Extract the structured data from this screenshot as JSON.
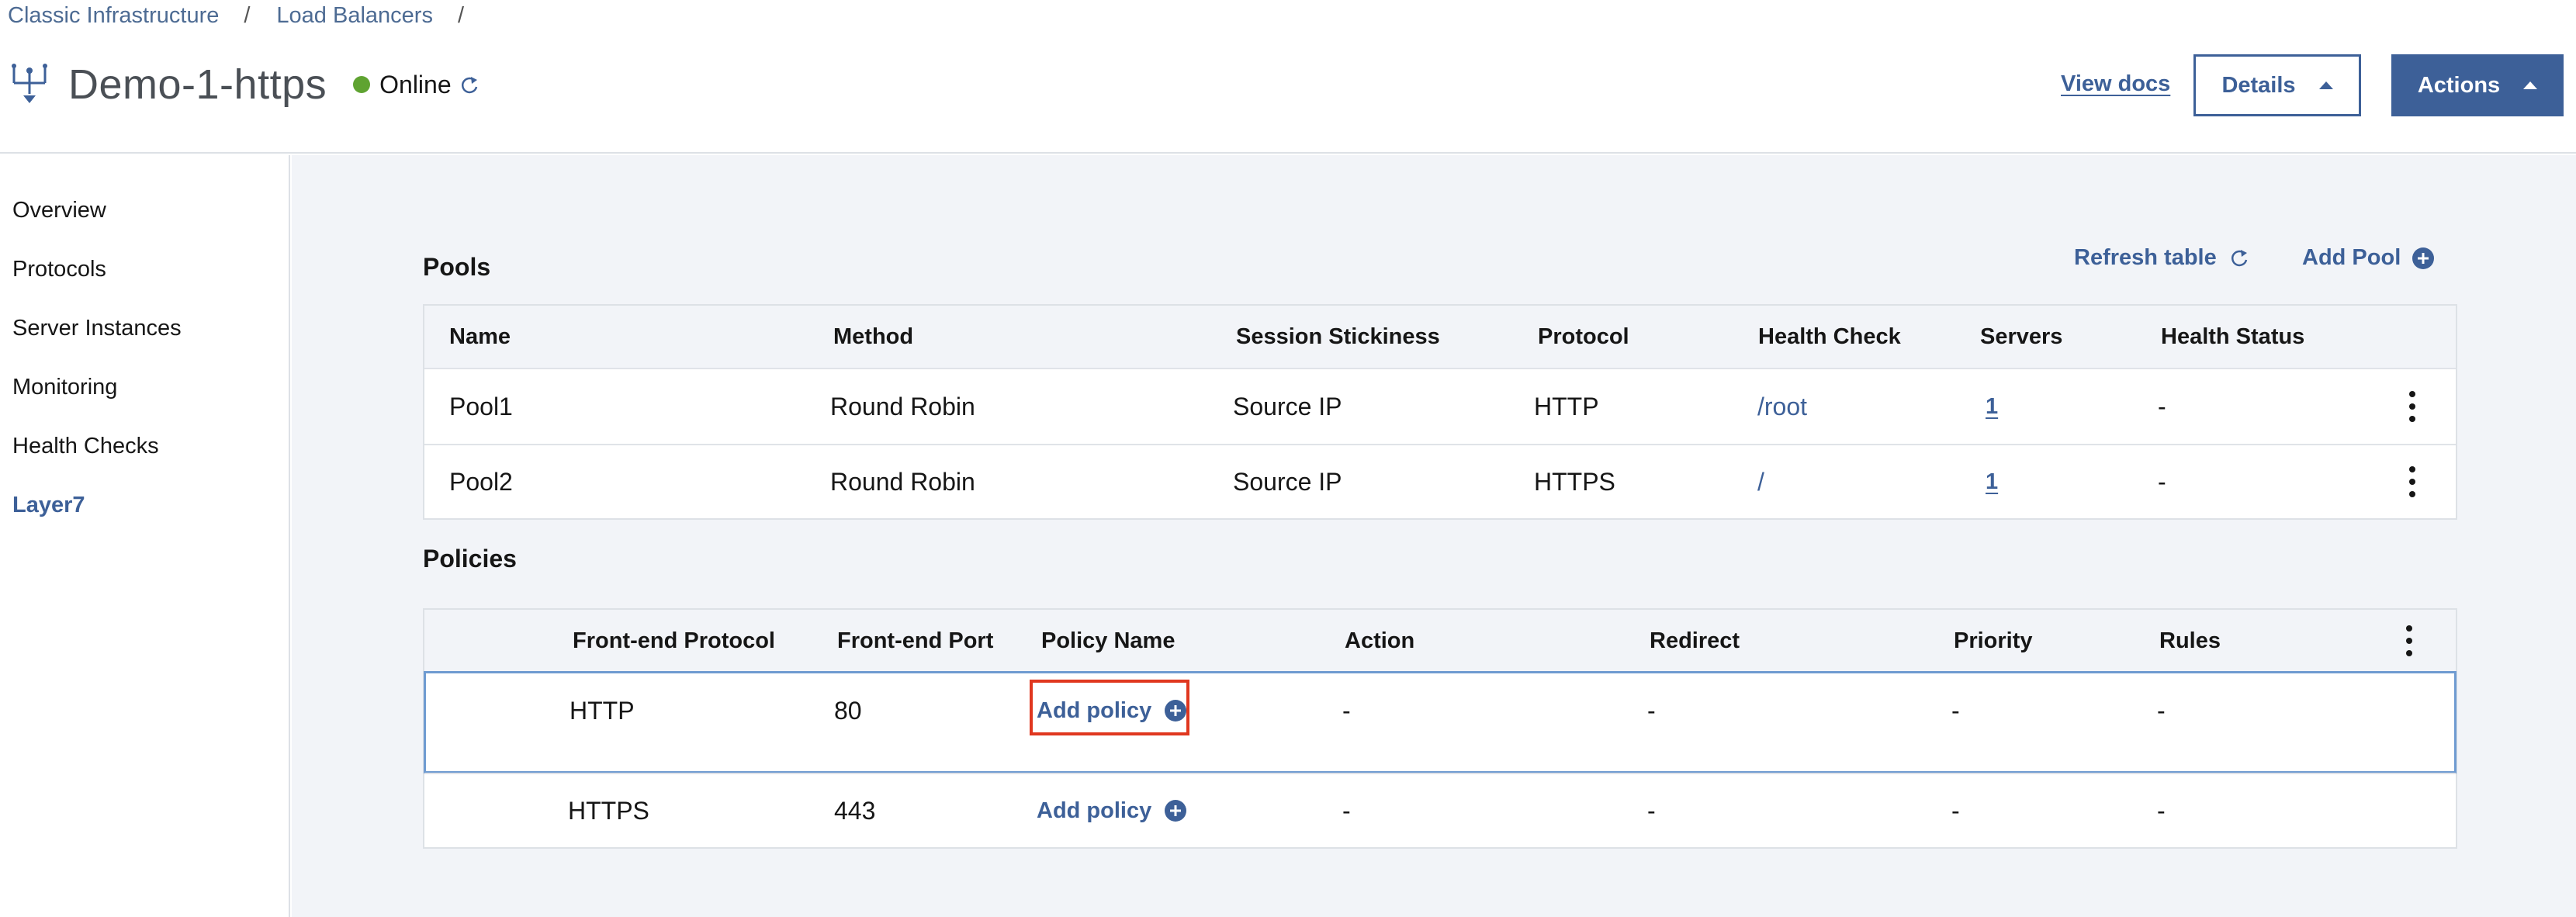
{
  "breadcrumb": {
    "items": [
      "Classic Infrastructure",
      "Load Balancers"
    ],
    "separator": "/"
  },
  "header": {
    "title": "Demo-1-https",
    "status": "Online",
    "status_color": "#5fa331",
    "view_docs": "View docs",
    "details_label": "Details",
    "actions_label": "Actions"
  },
  "sidebar": {
    "items": [
      {
        "label": "Overview"
      },
      {
        "label": "Protocols"
      },
      {
        "label": "Server Instances"
      },
      {
        "label": "Monitoring"
      },
      {
        "label": "Health Checks"
      },
      {
        "label": "Layer7",
        "active": true
      }
    ]
  },
  "pools": {
    "title": "Pools",
    "refresh_label": "Refresh table",
    "add_label": "Add Pool",
    "columns": [
      "Name",
      "Method",
      "Session Stickiness",
      "Protocol",
      "Health Check",
      "Servers",
      "Health Status"
    ],
    "rows": [
      {
        "name": "Pool1",
        "method": "Round Robin",
        "stickiness": "Source IP",
        "protocol": "HTTP",
        "health_check": "/root",
        "servers": "1",
        "health_status": "-"
      },
      {
        "name": "Pool2",
        "method": "Round Robin",
        "stickiness": "Source IP",
        "protocol": "HTTPS",
        "health_check": "/",
        "servers": "1",
        "health_status": "-"
      }
    ]
  },
  "policies": {
    "title": "Policies",
    "columns": [
      "Front-end Protocol",
      "Front-end Port",
      "Policy Name",
      "Action",
      "Redirect",
      "Priority",
      "Rules"
    ],
    "rows": [
      {
        "protocol": "HTTP",
        "port": "80",
        "policy": "Add policy",
        "action": "-",
        "redirect": "-",
        "priority": "-",
        "rules": "-"
      },
      {
        "protocol": "HTTPS",
        "port": "443",
        "policy": "Add policy",
        "action": "-",
        "redirect": "-",
        "priority": "-",
        "rules": "-"
      }
    ]
  },
  "colors": {
    "accent": "#3d6098",
    "highlight": "#e0371f"
  }
}
